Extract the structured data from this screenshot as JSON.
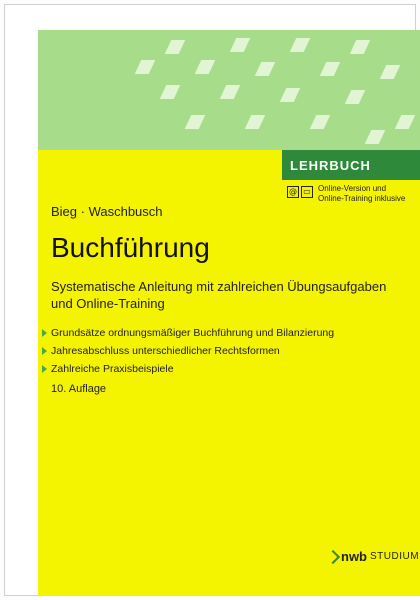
{
  "cover": {
    "series_label": "LEHRBUCH",
    "online_note": [
      "Online-Version und",
      "Online-Training inklusive"
    ],
    "authors": "Bieg · Waschbusch",
    "title": "Buchführung",
    "subtitle": "Systematische Anleitung mit zahlreichen Übungsaufgaben und Online-Training",
    "bullets": [
      "Grundsätze ordnungsmäßiger Buchführung und Bilanzierung",
      "Jahresabschluss unterschiedlicher Rechtsformen",
      "Zahlreiche Praxisbeispiele"
    ],
    "edition": "10. Auflage",
    "publisher": {
      "name": "nwb",
      "imprint": "STUDIUM"
    },
    "colors": {
      "yellow": "#f5f400",
      "green_band": "#a7dc8a",
      "brand_green": "#2e8a3a"
    }
  }
}
